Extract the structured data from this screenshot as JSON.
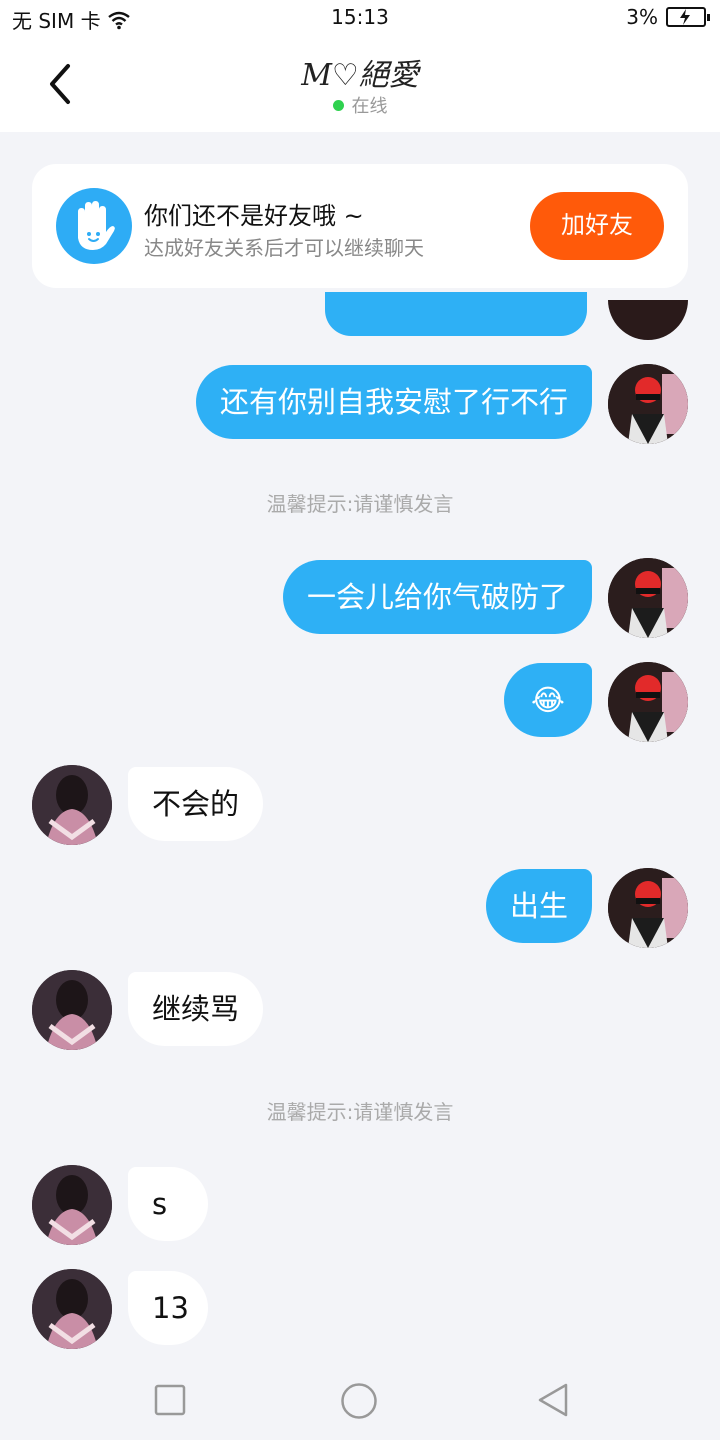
{
  "status_bar": {
    "carrier": "无 SIM 卡",
    "time": "15:13",
    "battery": "3%"
  },
  "header": {
    "title": "M♡絕愛",
    "status": "在线"
  },
  "friend_card": {
    "title": "你们还不是好友哦 ~",
    "subtitle": "达成好友关系后才可以继续聊天",
    "button": "加好友"
  },
  "messages": [
    {
      "from": "me",
      "text": "还有你别自我安慰了行不行"
    },
    {
      "type": "tip",
      "text": "温馨提示:请谨慎发言"
    },
    {
      "from": "me",
      "text": "一会儿给你气破防了"
    },
    {
      "from": "me",
      "text": "😂"
    },
    {
      "from": "them",
      "text": "不会的"
    },
    {
      "from": "me",
      "text": "出生"
    },
    {
      "from": "them",
      "text": "继续骂"
    },
    {
      "type": "tip",
      "text": "温馨提示:请谨慎发言"
    },
    {
      "from": "them",
      "text": "s"
    },
    {
      "from": "them",
      "text": "13"
    }
  ],
  "colors": {
    "accent_blue": "#2eb0f5",
    "add_friend_orange": "#ff5a0a",
    "online_green": "#2fd14f"
  },
  "icons": {
    "back": "chevron-left-icon",
    "friend_card": "hand-wave-icon",
    "nav_recents": "square-icon",
    "nav_home": "circle-icon",
    "nav_back": "triangle-icon"
  }
}
